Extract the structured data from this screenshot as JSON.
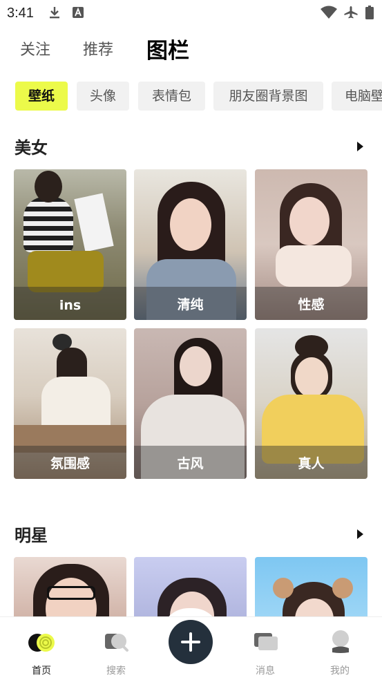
{
  "status_bar": {
    "time": "3:41",
    "icons": [
      "download-icon",
      "text-a-icon",
      "wifi-icon",
      "airplane-icon",
      "battery-icon"
    ]
  },
  "top_tabs": {
    "follow": "关注",
    "recommend": "推荐",
    "active": "图栏"
  },
  "chips": [
    "壁纸",
    "头像",
    "表情包",
    "朋友圈背景图",
    "电脑壁"
  ],
  "sections": [
    {
      "title": "美女",
      "cards": [
        "ins",
        "清纯",
        "性感",
        "氛围感",
        "古风",
        "真人"
      ]
    },
    {
      "title": "明星"
    }
  ],
  "bottom_nav": {
    "home": "首页",
    "search": "搜索",
    "messages": "消息",
    "mine": "我的"
  },
  "colors": {
    "accent": "#ecfa4a",
    "fab": "#24303c",
    "inactive_text": "#999999"
  }
}
